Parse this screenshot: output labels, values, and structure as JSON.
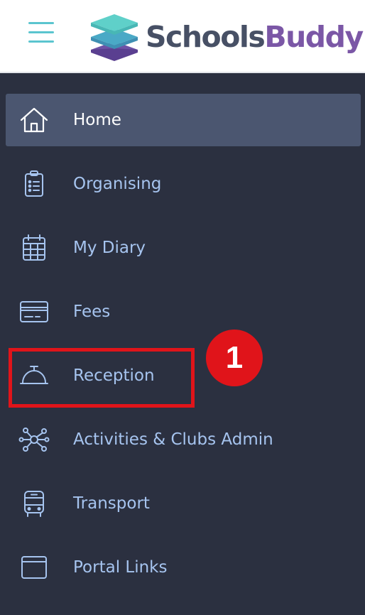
{
  "header": {
    "menu_icon": "hamburger-icon",
    "logo": {
      "part1": "Schools",
      "part2": "Buddy",
      "colors": [
        "#475065",
        "#7b57a6"
      ]
    }
  },
  "menu": {
    "items": [
      {
        "label": "Home",
        "icon": "home-icon",
        "active": true
      },
      {
        "label": "Organising",
        "icon": "clipboard-icon"
      },
      {
        "label": "My Diary",
        "icon": "calendar-icon"
      },
      {
        "label": "Fees",
        "icon": "credit-card-icon"
      },
      {
        "label": "Reception",
        "icon": "reception-bell-icon"
      },
      {
        "label": "Activities & Clubs Admin",
        "icon": "network-icon"
      },
      {
        "label": "Transport",
        "icon": "bus-icon"
      },
      {
        "label": "Portal Links",
        "icon": "browser-window-icon"
      }
    ]
  },
  "annotation": {
    "badge_number": "1",
    "color": "#e0141a"
  },
  "colors": {
    "sidebar_bg": "#2b3040",
    "active_bg": "#4b5670",
    "item_text": "#a6c4ef",
    "accent_teal": "#5bc5cf"
  }
}
